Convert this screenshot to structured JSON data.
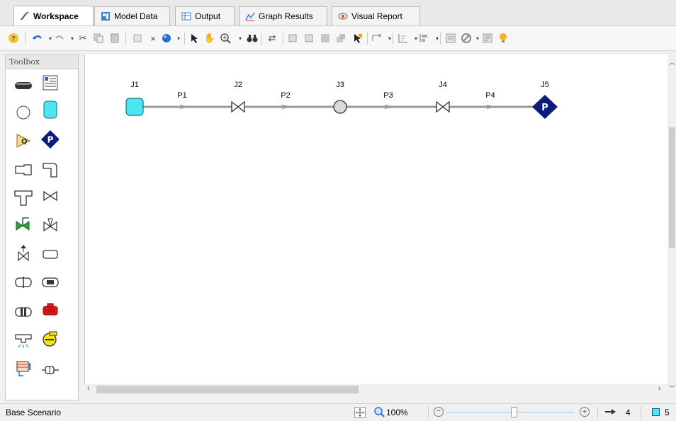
{
  "tabs": [
    {
      "label": "Workspace",
      "icon": "workspace-icon"
    },
    {
      "label": "Model Data",
      "icon": "model-data-icon"
    },
    {
      "label": "Output",
      "icon": "output-icon"
    },
    {
      "label": "Graph Results",
      "icon": "graph-icon"
    },
    {
      "label": "Visual Report",
      "icon": "eye-icon"
    }
  ],
  "toolbox": {
    "title": "Toolbox"
  },
  "model": {
    "junctions": [
      {
        "label": "J1",
        "type": "reservoir",
        "color": "#4fe4f1"
      },
      {
        "label": "J2",
        "type": "valve"
      },
      {
        "label": "J3",
        "type": "branch"
      },
      {
        "label": "J4",
        "type": "valve"
      },
      {
        "label": "J5",
        "type": "assigned-pressure",
        "color": "#0c1d7a",
        "symbol": "P"
      }
    ],
    "pipes": [
      {
        "label": "P1"
      },
      {
        "label": "P2"
      },
      {
        "label": "P3"
      },
      {
        "label": "P4"
      }
    ]
  },
  "status": {
    "scenario": "Base Scenario",
    "zoom": "100%",
    "pipe_count": "4",
    "junction_count": "5"
  },
  "colors": {
    "accent_cyan": "#4fe4f1",
    "pressure_blue": "#0c1d7a",
    "pipe_gray": "#9a9a9a"
  }
}
